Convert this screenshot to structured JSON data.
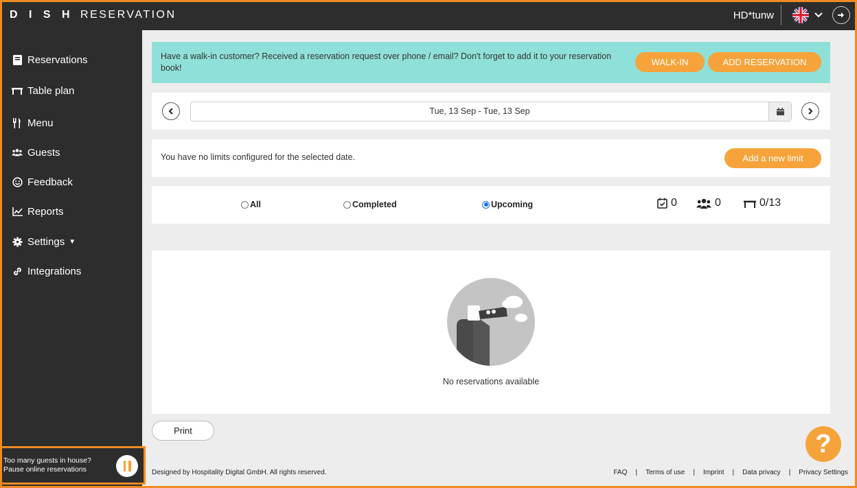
{
  "app": {
    "logo_bold": "D I S H",
    "logo_light": "RESERVATION"
  },
  "header": {
    "user": "HD*tunw",
    "language_flag": "uk-flag-icon",
    "logout_icon": "logout-icon"
  },
  "sidebar": {
    "items": [
      {
        "label": "Reservations",
        "icon": "book-icon",
        "active": true
      },
      {
        "label": "Table plan",
        "icon": "table-icon"
      },
      {
        "label": "Menu",
        "icon": "cutlery-icon"
      },
      {
        "label": "Guests",
        "icon": "users-icon"
      },
      {
        "label": "Feedback",
        "icon": "smile-icon"
      },
      {
        "label": "Reports",
        "icon": "chart-icon"
      },
      {
        "label": "Settings",
        "icon": "gear-icon"
      },
      {
        "label": "Integrations",
        "icon": "link-icon"
      }
    ],
    "pause": {
      "line1": "Too many guests in house?",
      "line2": "Pause online reservations"
    }
  },
  "banner": {
    "text": "Have a walk-in customer? Received a reservation request over phone / email? Don't forget to add it to your reservation book!",
    "walkin_label": "WALK-IN",
    "add_label": "ADD RESERVATION"
  },
  "date_nav": {
    "range": "Tue, 13 Sep - Tue, 13 Sep"
  },
  "limits": {
    "message": "You have no limits configured for the selected date.",
    "button": "Add a new limit"
  },
  "filters": {
    "all": "All",
    "completed": "Completed",
    "upcoming": "Upcoming",
    "selected": "Upcoming",
    "reservations_count": "0",
    "guests_count": "0",
    "tables": "0/13"
  },
  "empty": {
    "message": "No reservations available"
  },
  "print_label": "Print",
  "help_label": "?",
  "footer": {
    "copyright": "Designed by Hospitality Digital GmbH. All rights reserved.",
    "links": [
      "FAQ",
      "Terms of use",
      "Imprint",
      "Data privacy",
      "Privacy Settings"
    ]
  },
  "colors": {
    "accent": "#f5a33a",
    "banner": "#8fe0d8",
    "sidebar": "#2d2d2d",
    "frame": "#f08a24"
  }
}
